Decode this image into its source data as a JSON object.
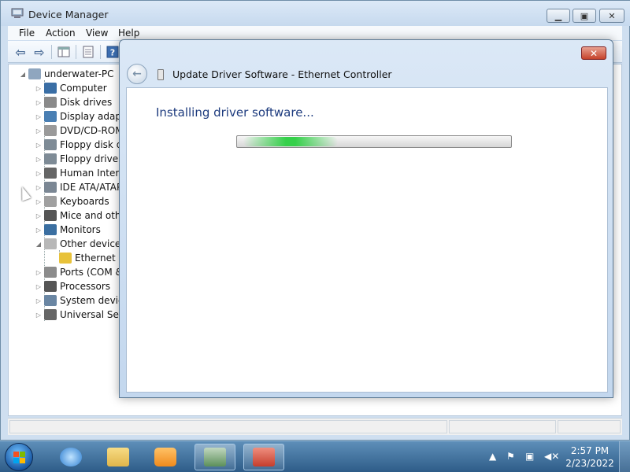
{
  "device_manager": {
    "title": "Device Manager",
    "menu": [
      "File",
      "Action",
      "View",
      "Help"
    ],
    "tree": {
      "root": "underwater-PC",
      "items": [
        {
          "label": "Computer",
          "expander": "▷",
          "icon_color": "#3a6ea5"
        },
        {
          "label": "Disk drives",
          "expander": "▷",
          "icon_color": "#8a8a8a"
        },
        {
          "label": "Display adapte",
          "expander": "▷",
          "icon_color": "#4a7fb3"
        },
        {
          "label": "DVD/CD-ROM",
          "expander": "▷",
          "icon_color": "#9a9a9a"
        },
        {
          "label": "Floppy disk dr",
          "expander": "▷",
          "icon_color": "#7e8b96"
        },
        {
          "label": "Floppy drive c",
          "expander": "▷",
          "icon_color": "#7e8b96"
        },
        {
          "label": "Human Interfa",
          "expander": "▷",
          "icon_color": "#666666"
        },
        {
          "label": "IDE ATA/ATAP",
          "expander": "▷",
          "icon_color": "#7b8794"
        },
        {
          "label": "Keyboards",
          "expander": "▷",
          "icon_color": "#a0a0a0"
        },
        {
          "label": "Mice and othe",
          "expander": "▷",
          "icon_color": "#555555"
        },
        {
          "label": "Monitors",
          "expander": "▷",
          "icon_color": "#3b6fa1"
        },
        {
          "label": "Other devices",
          "expander": "◢",
          "icon_color": "#b8b8b8"
        },
        {
          "label": "Ethernet C",
          "expander": "",
          "icon_color": "#e8c23a",
          "child": true
        },
        {
          "label": "Ports (COM &",
          "expander": "▷",
          "icon_color": "#8c8c8c"
        },
        {
          "label": "Processors",
          "expander": "▷",
          "icon_color": "#555555"
        },
        {
          "label": "System device",
          "expander": "▷",
          "icon_color": "#6a86a3"
        },
        {
          "label": "Universal Seria",
          "expander": "▷",
          "icon_color": "#666666"
        }
      ]
    }
  },
  "dialog": {
    "title": "Update Driver Software - Ethernet Controller",
    "message": "Installing driver software...",
    "close_glyph": "✕",
    "progress_indeterminate": true
  },
  "taskbar": {
    "clock_time": "2:57 PM",
    "clock_date": "2/23/2022",
    "pinned": [
      {
        "name": "internet-explorer-icon",
        "color": "#2f7fd1"
      },
      {
        "name": "file-explorer-icon",
        "color": "#e9c45a"
      },
      {
        "name": "media-player-icon",
        "color": "#f08a1c"
      },
      {
        "name": "device-manager-task-icon",
        "color": "#5c8f5a"
      },
      {
        "name": "toolbox-task-icon",
        "color": "#c53d2c"
      }
    ]
  }
}
